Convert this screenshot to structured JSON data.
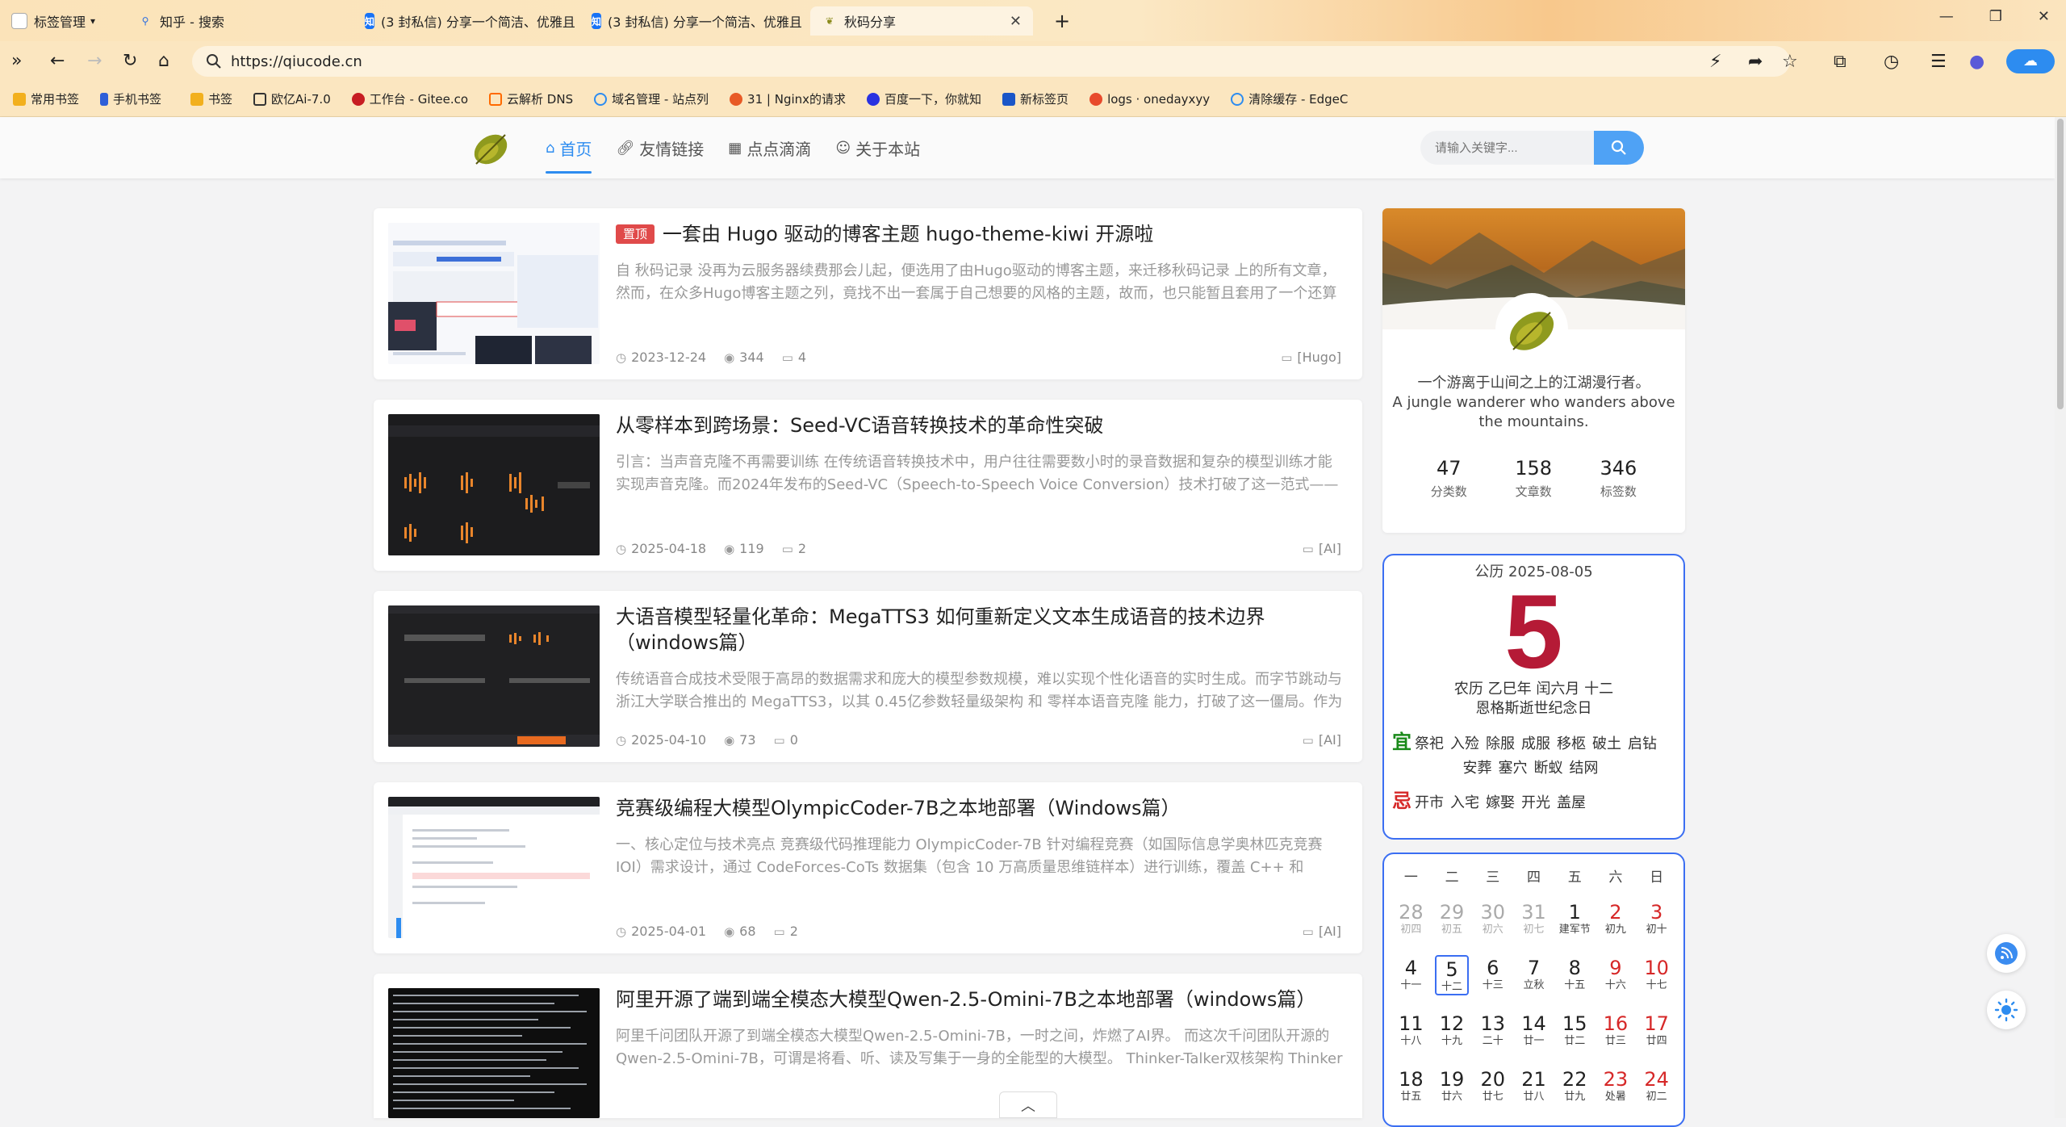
{
  "browser": {
    "tabs": [
      {
        "label": "标签管理",
        "icon": "tab-manager-icon"
      },
      {
        "label": "知乎 - 搜索",
        "icon": "search-icon"
      },
      {
        "label": "(3 封私信) 分享一个简洁、优雅且",
        "icon": "zhihu-icon"
      },
      {
        "label": "(3 封私信) 分享一个简洁、优雅且",
        "icon": "zhihu-icon"
      },
      {
        "label": "秋码分享",
        "icon": "leaf-icon"
      }
    ],
    "url": "https://qiucode.cn",
    "bookmarks": [
      "常用书签",
      "手机书签",
      "书签",
      "欧亿Ai-7.0",
      "工作台 - Gitee.co",
      "云解析 DNS",
      "域名管理 - 站点列",
      "31 | Nginx的请求",
      "百度一下，你就知",
      "新标签页",
      "logs · onedayxyy",
      "清除缓存 - EdgeC"
    ]
  },
  "site": {
    "nav": [
      {
        "label": "首页",
        "icon": "home-icon"
      },
      {
        "label": "友情链接",
        "icon": "link-icon"
      },
      {
        "label": "点点滴滴",
        "icon": "calendar-icon"
      },
      {
        "label": "关于本站",
        "icon": "user-icon"
      }
    ],
    "search_placeholder": "请输入关键字..."
  },
  "posts": [
    {
      "badge": "置顶",
      "title": "一套由 Hugo 驱动的博客主题 hugo-theme-kiwi 开源啦",
      "summary": "自 秋码记录 没再为云服务器续费那会儿起，便选用了由Hugo驱动的博客主题，来迁移秋码记录 上的所有文章，然而，在众多Hugo博客主题之列，竟找不出一套属于自己想要的风格的主题，故而，也只能暂且套用了一个还算可以...",
      "date": "2023-12-24",
      "views": "344",
      "comments": "4",
      "category": "[Hugo]"
    },
    {
      "badge": "",
      "title": "从零样本到跨场景：Seed-VC语音转换技术的革命性突破",
      "summary": "引言：当声音克隆不再需要训练 在传统语音转换技术中，用户往往需要数小时的录音数据和复杂的模型训练才能实现声音克隆。而2024年发布的Seed-VC（Speech-to-Speech Voice Conversion）技术打破了这一范式——它通过零...",
      "date": "2025-04-18",
      "views": "119",
      "comments": "2",
      "category": "[AI]"
    },
    {
      "badge": "",
      "title": "大语音模型轻量化革命：MegaTTS3 如何重新定义文本生成语音的技术边界（windows篇）",
      "summary": "传统语音合成技术受限于高昂的数据需求和庞大的模型参数规模，难以实现个性化语音的实时生成。而字节跳动与浙江大学联合推出的 MegaTTS3，以其 0.45亿参数轻量级架构 和 零样本语音克隆 能力，打破了这一僵局。作为首个...",
      "date": "2025-04-10",
      "views": "73",
      "comments": "0",
      "category": "[AI]"
    },
    {
      "badge": "",
      "title": "竞赛级编程大模型OlympicCoder-7B之本地部署（Windows篇）",
      "summary": "一、核心定位与技术亮点 竞赛级代码推理能力 OlympicCoder-7B 针对编程竞赛（如国际信息学奥林匹克竞赛 IOI）需求设计，通过 CodeForces-CoTs 数据集（包含 10 万高质量思维链样本）进行训练，覆盖 C++ 和 Python 语言...",
      "date": "2025-04-01",
      "views": "68",
      "comments": "2",
      "category": "[AI]"
    },
    {
      "badge": "",
      "title": "阿里开源了端到端全模态大模型Qwen-2.5-Omini-7B之本地部署（windows篇）",
      "summary": "阿里千问团队开源了到端全模态大模型Qwen-2.5-Omini-7B，一时之间，炸燃了AI界。 而这次千问团队开源的Qwen-2.5-Omini-7B，可谓是将看、听、读及写集于一身的全能型的大模型。 Thinker-Talker双核架构 Thinker模...",
      "date": "",
      "views": "",
      "comments": "",
      "category": ""
    }
  ],
  "profile": {
    "bio_cn": "一个游离于山间之上的江湖漫行者。",
    "bio_en": "A jungle wanderer who wanders above the mountains.",
    "stats": [
      {
        "value": "47",
        "label": "分类数"
      },
      {
        "value": "158",
        "label": "文章数"
      },
      {
        "value": "346",
        "label": "标签数"
      }
    ]
  },
  "almanac": {
    "solar": "公历 2025-08-05",
    "day": "5",
    "lunar": "农历 乙巳年 闰六月 十二",
    "festival": "恩格斯逝世纪念日",
    "yi_label": "宜",
    "yi": [
      "祭祀",
      "入殓",
      "除服",
      "成服",
      "移柩",
      "破土",
      "启钻",
      "安葬",
      "塞穴",
      "断蚁",
      "结网"
    ],
    "ji_label": "忌",
    "ji": [
      "开市",
      "入宅",
      "嫁娶",
      "开光",
      "盖屋"
    ]
  },
  "calendar": {
    "weekdays": [
      "一",
      "二",
      "三",
      "四",
      "五",
      "六",
      "日"
    ],
    "days": [
      {
        "d": "28",
        "s": "初四",
        "type": "other"
      },
      {
        "d": "29",
        "s": "初五",
        "type": "other"
      },
      {
        "d": "30",
        "s": "初六",
        "type": "other"
      },
      {
        "d": "31",
        "s": "初七",
        "type": "other"
      },
      {
        "d": "1",
        "s": "建军节",
        "type": ""
      },
      {
        "d": "2",
        "s": "初九",
        "type": "red"
      },
      {
        "d": "3",
        "s": "初十",
        "type": "red"
      },
      {
        "d": "4",
        "s": "十一",
        "type": ""
      },
      {
        "d": "5",
        "s": "十二",
        "type": "today"
      },
      {
        "d": "6",
        "s": "十三",
        "type": ""
      },
      {
        "d": "7",
        "s": "立秋",
        "type": ""
      },
      {
        "d": "8",
        "s": "十五",
        "type": ""
      },
      {
        "d": "9",
        "s": "十六",
        "type": "red"
      },
      {
        "d": "10",
        "s": "十七",
        "type": "red"
      },
      {
        "d": "11",
        "s": "十八",
        "type": ""
      },
      {
        "d": "12",
        "s": "十九",
        "type": ""
      },
      {
        "d": "13",
        "s": "二十",
        "type": ""
      },
      {
        "d": "14",
        "s": "廿一",
        "type": ""
      },
      {
        "d": "15",
        "s": "廿二",
        "type": ""
      },
      {
        "d": "16",
        "s": "廿三",
        "type": "red"
      },
      {
        "d": "17",
        "s": "廿四",
        "type": "red"
      },
      {
        "d": "18",
        "s": "廿五",
        "type": ""
      },
      {
        "d": "19",
        "s": "廿六",
        "type": ""
      },
      {
        "d": "20",
        "s": "廿七",
        "type": ""
      },
      {
        "d": "21",
        "s": "廿八",
        "type": ""
      },
      {
        "d": "22",
        "s": "廿九",
        "type": ""
      },
      {
        "d": "23",
        "s": "处暑",
        "type": "red"
      },
      {
        "d": "24",
        "s": "初二",
        "type": "red"
      }
    ]
  },
  "colors": {
    "accent": "#2d8cf0",
    "almanac_red": "#b51a36",
    "border_blue": "#3b6ef2"
  }
}
